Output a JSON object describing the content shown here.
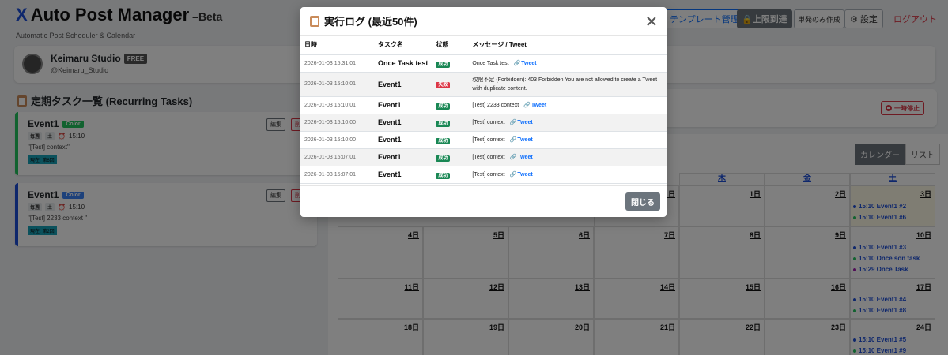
{
  "app": {
    "title": "Auto Post Manager",
    "beta": "–Beta",
    "tagline": "Automatic Post Scheduler & Calendar"
  },
  "user": {
    "name": "Keimaru Studio",
    "plan": "FREE",
    "handle": "@Keimaru_Studio"
  },
  "toolbar": {
    "template_label": "テンプレート管理",
    "limit_label": "上限到達",
    "once_label": "単発のみ作成",
    "settings_label": "設定",
    "logout_label": "ログアウト"
  },
  "tasks": {
    "section_title": "定期タスク一覧 (Recurring Tasks)",
    "items": [
      {
        "name": "Event1",
        "tag": "Color",
        "freq": "毎週",
        "day": "土",
        "time": "15:10",
        "text": "\"[Test] context\"",
        "progress": "現在: 第6回",
        "edit": "編集",
        "del": "削"
      },
      {
        "name": "Event1",
        "tag": "Color",
        "freq": "毎週",
        "day": "土",
        "time": "15:10",
        "text": "\"[Test] 2233 context \"",
        "progress": "現在: 第2回",
        "edit": "編集",
        "del": "削"
      }
    ]
  },
  "pause_label": "一時停止",
  "calendar": {
    "view_calendar": "カレンダー",
    "view_list": "リスト",
    "headers": [
      "木",
      "金",
      "土"
    ],
    "rows": [
      {
        "cells": [
          {
            "day": "1日"
          },
          {
            "day": "1日"
          },
          {
            "day": "2日"
          },
          {
            "day": "3日"
          }
        ]
      },
      {
        "cells": [
          {
            "day": "4日"
          },
          {
            "day": "5日"
          },
          {
            "day": "6日"
          },
          {
            "day": "7日"
          },
          {
            "day": "8日"
          },
          {
            "day": "9日"
          },
          {
            "day": "10日"
          }
        ]
      },
      {
        "cells": [
          {
            "day": "11日"
          },
          {
            "day": "12日"
          },
          {
            "day": "13日"
          },
          {
            "day": "14日"
          },
          {
            "day": "15日"
          },
          {
            "day": "16日"
          },
          {
            "day": "17日"
          }
        ]
      },
      {
        "cells": [
          {
            "day": "18日"
          },
          {
            "day": "19日"
          },
          {
            "day": "20日"
          },
          {
            "day": "21日"
          },
          {
            "day": "22日"
          },
          {
            "day": "23日"
          },
          {
            "day": "24日"
          }
        ]
      }
    ],
    "saturday_events": [
      [
        {
          "text": "15:10 Event1 #2",
          "color": "#1d4ed8"
        },
        {
          "text": "15:10 Event1 #6",
          "color": "#22c55e"
        }
      ],
      [
        {
          "text": "15:10 Event1 #3",
          "color": "#1d4ed8"
        },
        {
          "text": "15:10 Once son task",
          "color": "#22c55e"
        },
        {
          "text": "15:29 Once Task",
          "color": "#a21caf"
        }
      ],
      [
        {
          "text": "15:10 Event1 #4",
          "color": "#1d4ed8"
        },
        {
          "text": "15:10 Event1 #8",
          "color": "#22c55e"
        }
      ],
      [
        {
          "text": "15:10 Event1 #5",
          "color": "#1d4ed8"
        },
        {
          "text": "15:10 Event1 #9",
          "color": "#22c55e"
        }
      ]
    ]
  },
  "modal": {
    "title": "実行ログ (最近50件)",
    "columns": [
      "日時",
      "タスク名",
      "状態",
      "メッセージ / Tweet"
    ],
    "rows": [
      {
        "time": "2026-01-03 15:31:01",
        "task": "Once Task test",
        "status": "成功",
        "ok": true,
        "msg": "Once Task test",
        "link": "Tweet"
      },
      {
        "time": "2026-01-03 15:10:01",
        "task": "Event1",
        "status": "失敗",
        "ok": false,
        "msg": "权限不足 (Forbidden): 403 Forbidden You are not allowed to create a Tweet with duplicate content.",
        "link": ""
      },
      {
        "time": "2026-01-03 15:10:01",
        "task": "Event1",
        "status": "成功",
        "ok": true,
        "msg": "[Test] 2233 context",
        "link": "Tweet"
      },
      {
        "time": "2026-01-03 15:10:00",
        "task": "Event1",
        "status": "成功",
        "ok": true,
        "msg": "[Test] context",
        "link": "Tweet"
      },
      {
        "time": "2026-01-03 15:10:00",
        "task": "Event1",
        "status": "成功",
        "ok": true,
        "msg": "[Test] context",
        "link": "Tweet"
      },
      {
        "time": "2026-01-03 15:07:01",
        "task": "Event1",
        "status": "成功",
        "ok": true,
        "msg": "[Test] context",
        "link": "Tweet"
      },
      {
        "time": "2026-01-03 15:07:01",
        "task": "Event1",
        "status": "成功",
        "ok": true,
        "msg": "[Test] context",
        "link": "Tweet"
      }
    ],
    "close_label": "閉じる"
  }
}
